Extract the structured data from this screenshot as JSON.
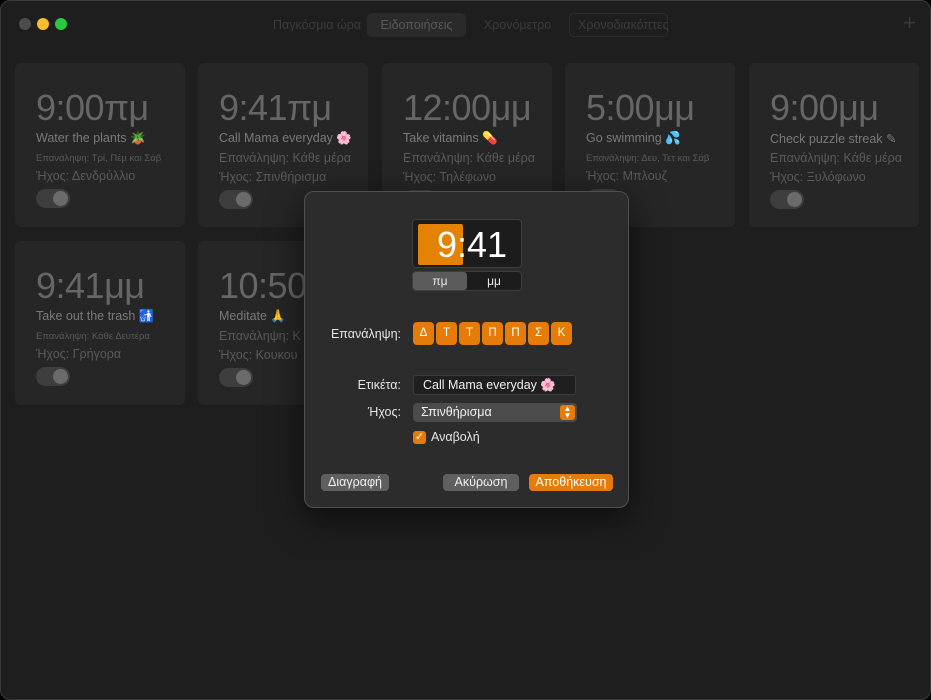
{
  "window": {
    "tabs": [
      {
        "label": "Παγκόσμια ώρα"
      },
      {
        "label": "Ειδοποιήσεις"
      },
      {
        "label": "Χρονόμετρο"
      },
      {
        "label": "Χρονοδιακόπτες"
      }
    ],
    "add_label": "+"
  },
  "alarms": [
    {
      "time": "9:00πμ",
      "label": "Water the plants 🪴",
      "repeat": "Επανάληψη: Τρί, Πέμ και Σάβ",
      "sound": "Ήχος: Δενδρύλλιο",
      "enabled": true
    },
    {
      "time": "9:41πμ",
      "label": "Call Mama everyday 🌸",
      "repeat": "Επανάληψη: Κάθε μέρα",
      "sound": "Ήχος: Σπινθήρισμα",
      "enabled": true
    },
    {
      "time": "12:00μμ",
      "label": "Take vitamins 💊",
      "repeat": "Επανάληψη: Κάθε μέρα",
      "sound": "Ήχος: Τηλέφωνο",
      "enabled": true
    },
    {
      "time": "5:00μμ",
      "label": "Go swimming 💦",
      "repeat": "Επανάληψη: Δευ, Τετ και Σάβ",
      "sound": "Ήχος: Μπλουζ",
      "enabled": true
    },
    {
      "time": "9:00μμ",
      "label": "Check puzzle streak ✎",
      "repeat": "Επανάληψη: Κάθε μέρα",
      "sound": "Ήχος: Ξυλόφωνο",
      "enabled": true
    },
    {
      "time": "9:41μμ",
      "label": "Take out the trash 🚮",
      "repeat": "Επανάληψη: Κάθε Δευτέρα",
      "sound": "Ήχος: Γρήγορα",
      "enabled": true
    },
    {
      "time": "10:50",
      "label": "Meditate 🙏",
      "repeat": "Επανάληψη: Κ",
      "sound": "Ήχος: Κουκου",
      "enabled": true
    }
  ],
  "editor": {
    "time_hour": "9",
    "time_rest": ":41",
    "am_label": "πμ",
    "pm_label": "μμ",
    "repeat_label": "Επανάληψη:",
    "days": [
      "Δ",
      "Τ",
      "Τ",
      "Π",
      "Π",
      "Σ",
      "Κ"
    ],
    "label_label": "Ετικέτα:",
    "label_value": "Call Mama everyday 🌸",
    "sound_label": "Ήχος:",
    "sound_value": "Σπινθήρισμα",
    "snooze_label": "Αναβολή",
    "snooze_checked": true,
    "delete_label": "Διαγραφή",
    "cancel_label": "Ακύρωση",
    "save_label": "Αποθήκευση"
  },
  "colors": {
    "accent": "#e57b08"
  }
}
